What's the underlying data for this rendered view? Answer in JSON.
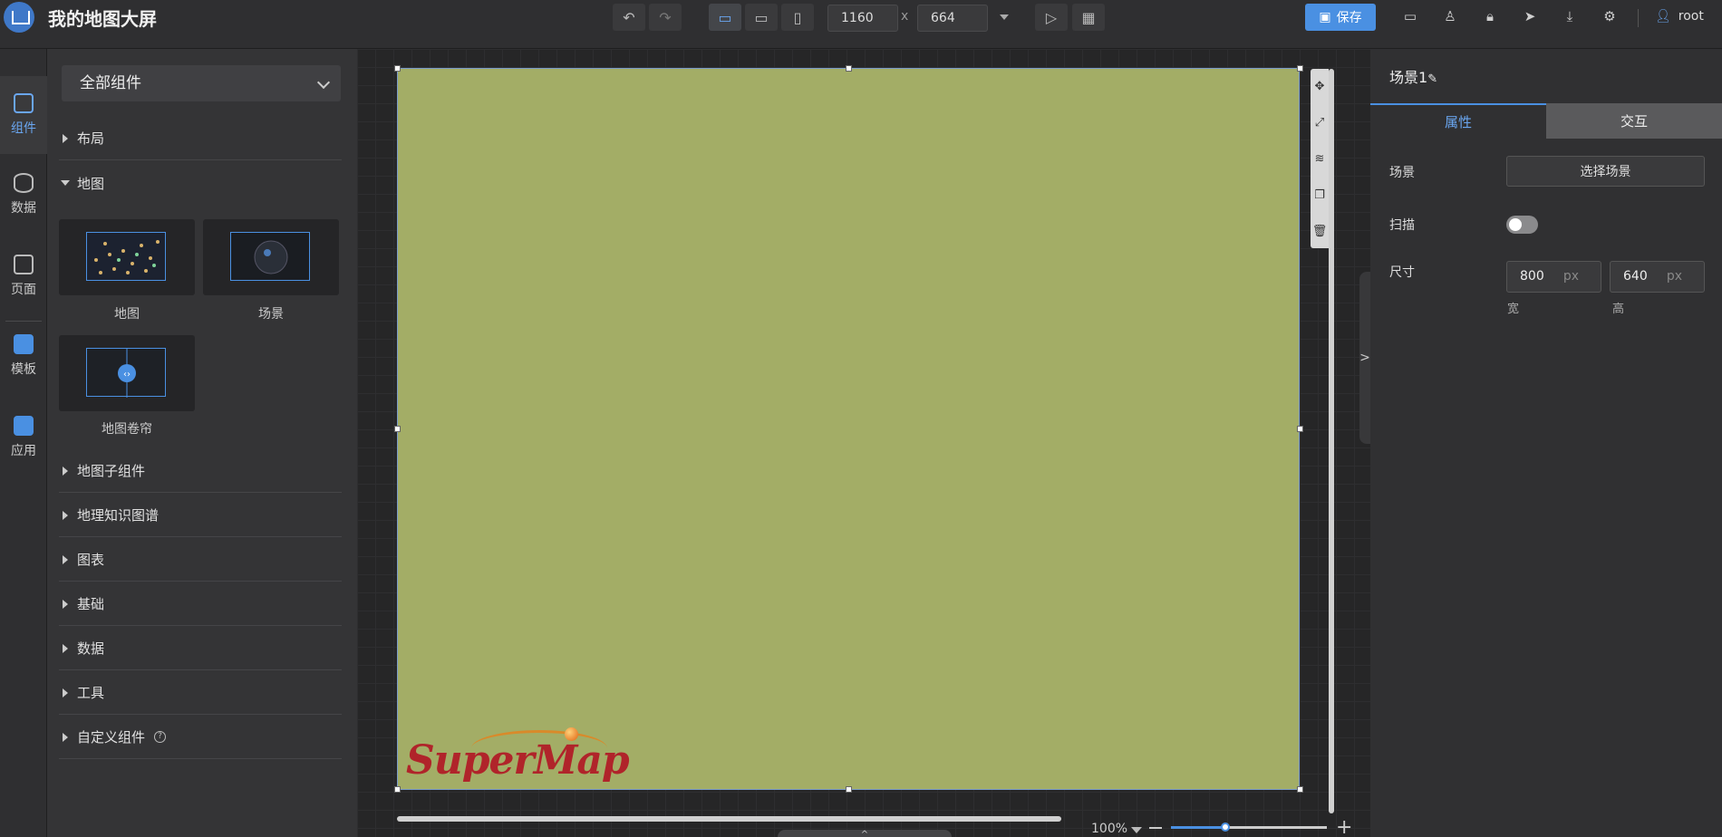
{
  "header": {
    "title": "我的地图大屏",
    "width_value": "1160",
    "height_value": "664",
    "times": "x",
    "save_label": "保存",
    "user_name": "root"
  },
  "rail": {
    "items": [
      {
        "label": "组件",
        "icon": "components-icon"
      },
      {
        "label": "数据",
        "icon": "database-icon"
      },
      {
        "label": "页面",
        "icon": "pages-icon"
      },
      {
        "label": "模板",
        "icon": "template-icon"
      },
      {
        "label": "应用",
        "icon": "app-icon"
      }
    ]
  },
  "panel": {
    "dropdown_value": "全部组件",
    "categories": [
      "布局",
      "地图",
      "地图子组件",
      "地理知识图谱",
      "图表",
      "基础",
      "数据",
      "工具",
      "自定义组件"
    ],
    "map_components": [
      "地图",
      "场景",
      "地图卷帘"
    ]
  },
  "canvas": {
    "logo_text": "SuperMap",
    "zoom": "100%",
    "zoom_level": 0.35,
    "collapse_glyph": ">"
  },
  "right_panel": {
    "scene_title": "场景1",
    "tabs": [
      "属性",
      "交互"
    ],
    "scene_label": "场景",
    "select_scene": "选择场景",
    "scan_label": "扫描",
    "scan_on": false,
    "size_label": "尺寸",
    "width": "800",
    "height": "640",
    "unit": "px",
    "width_label": "宽",
    "height_label": "高"
  },
  "colors": {
    "accent": "#4a90e2",
    "scene_bg": "#a3ad66"
  }
}
